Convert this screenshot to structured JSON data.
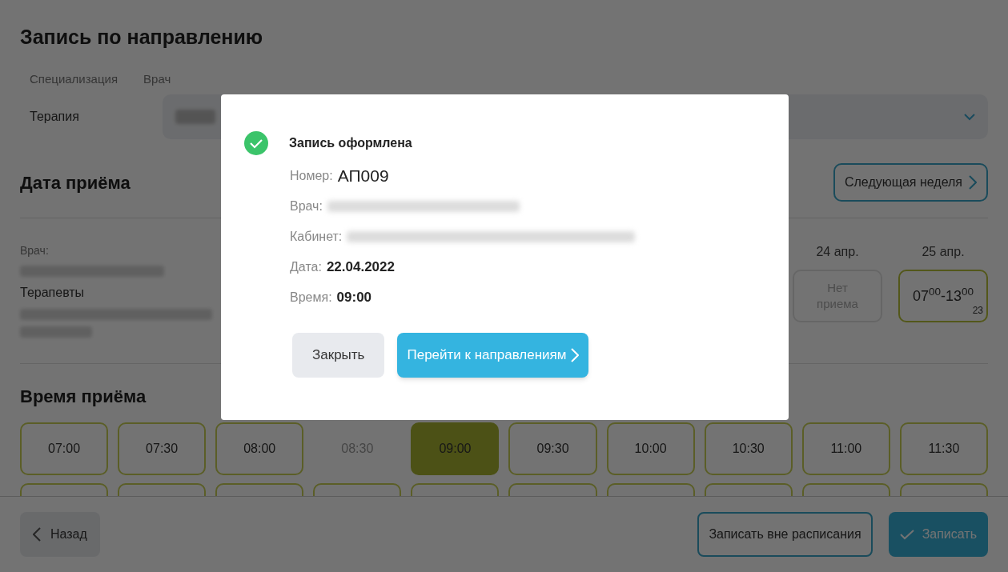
{
  "page_title": "Запись по направлению",
  "filters": {
    "labels": [
      "Специализация",
      "Врач"
    ],
    "specialization": "Терапия"
  },
  "date_section": {
    "heading": "Дата приёма",
    "next_week_button": "Следующая неделя",
    "doctor_label": "Врач:",
    "doctor_group": "Терапевты",
    "days": [
      {
        "date": "24 апр.",
        "kind": "none",
        "text": "Нет приема"
      },
      {
        "date": "25 апр.",
        "kind": "hours",
        "text": "07$^{00}$-13$^{00}$",
        "count": "23"
      }
    ]
  },
  "time_section": {
    "heading": "Время приёма",
    "slots": [
      {
        "time": "07:00",
        "selected": false,
        "disabled": false
      },
      {
        "time": "07:30",
        "selected": false,
        "disabled": false
      },
      {
        "time": "08:00",
        "selected": false,
        "disabled": false
      },
      {
        "time": "08:30",
        "selected": false,
        "disabled": true
      },
      {
        "time": "09:00",
        "selected": true,
        "disabled": false
      },
      {
        "time": "09:30",
        "selected": false,
        "disabled": false
      },
      {
        "time": "10:00",
        "selected": false,
        "disabled": false
      },
      {
        "time": "10:30",
        "selected": false,
        "disabled": false
      },
      {
        "time": "11:00",
        "selected": false,
        "disabled": false
      },
      {
        "time": "11:30",
        "selected": false,
        "disabled": false
      }
    ]
  },
  "footer": {
    "back": "Назад",
    "off_schedule": "Записать вне расписания",
    "submit": "Записать"
  },
  "dialog": {
    "success": true,
    "title": "Запись оформлена",
    "fields": [
      {
        "label": "Номер:",
        "kind": "large",
        "value": "АП009"
      },
      {
        "label": "Врач:",
        "kind": "redacted"
      },
      {
        "label": "Кабинет:",
        "kind": "redacted"
      },
      {
        "label": "Дата:",
        "kind": "bold",
        "value": "22.04.2022"
      },
      {
        "label": "Время:",
        "kind": "bold",
        "value": "09:00"
      }
    ],
    "close": "Закрыть",
    "primary": "Перейти к направлениям"
  }
}
